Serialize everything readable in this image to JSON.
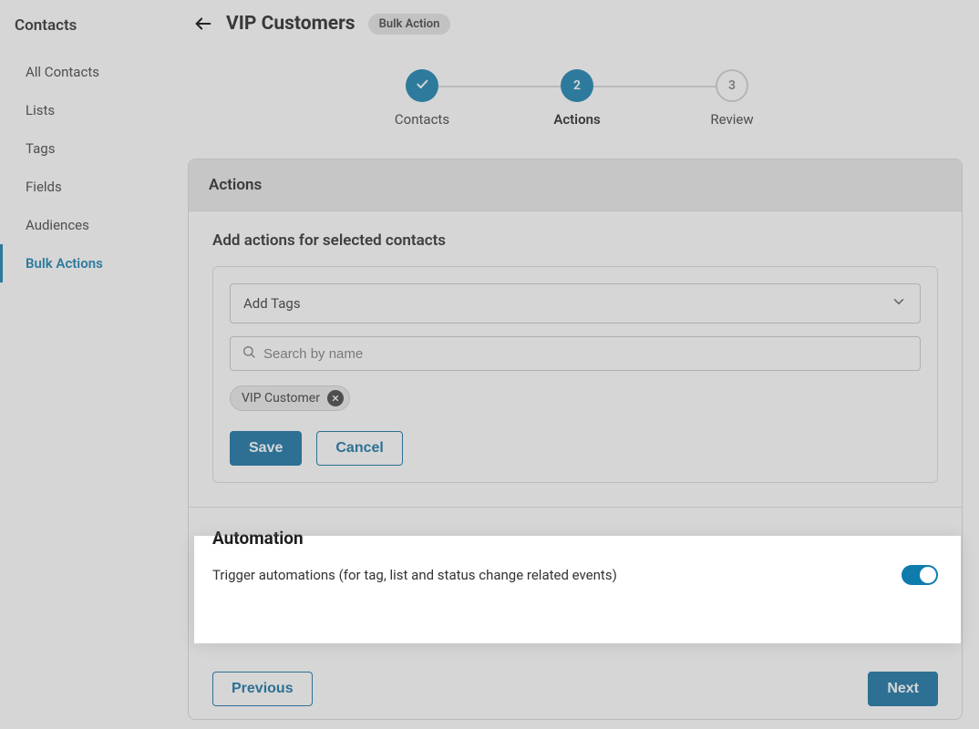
{
  "sidebar": {
    "title": "Contacts",
    "items": [
      {
        "label": "All Contacts",
        "active": false
      },
      {
        "label": "Lists",
        "active": false
      },
      {
        "label": "Tags",
        "active": false
      },
      {
        "label": "Fields",
        "active": false
      },
      {
        "label": "Audiences",
        "active": false
      },
      {
        "label": "Bulk Actions",
        "active": true
      }
    ]
  },
  "header": {
    "title": "VIP Customers",
    "badge": "Bulk Action"
  },
  "stepper": {
    "steps": [
      {
        "label": "Contacts",
        "state": "done",
        "number": ""
      },
      {
        "label": "Actions",
        "state": "current",
        "number": "2"
      },
      {
        "label": "Review",
        "state": "upcoming",
        "number": "3"
      }
    ]
  },
  "card": {
    "title": "Actions",
    "subtitle": "Add actions for selected contacts",
    "action_type_selected": "Add Tags",
    "search_placeholder": "Search by name",
    "tags": [
      "VIP Customer"
    ],
    "save_label": "Save",
    "cancel_label": "Cancel"
  },
  "automation": {
    "title": "Automation",
    "description": "Trigger automations (for tag, list and status change related events)",
    "enabled": true
  },
  "footer": {
    "previous_label": "Previous",
    "next_label": "Next"
  },
  "colors": {
    "accent": "#0d7cad",
    "primary_button": "#0d6ea0"
  }
}
